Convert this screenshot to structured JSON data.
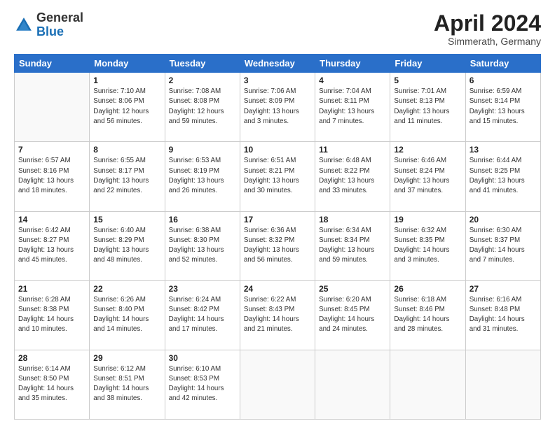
{
  "header": {
    "logo_general": "General",
    "logo_blue": "Blue",
    "month": "April 2024",
    "location": "Simmerath, Germany"
  },
  "weekdays": [
    "Sunday",
    "Monday",
    "Tuesday",
    "Wednesday",
    "Thursday",
    "Friday",
    "Saturday"
  ],
  "weeks": [
    [
      {
        "day": "",
        "info": ""
      },
      {
        "day": "1",
        "info": "Sunrise: 7:10 AM\nSunset: 8:06 PM\nDaylight: 12 hours\nand 56 minutes."
      },
      {
        "day": "2",
        "info": "Sunrise: 7:08 AM\nSunset: 8:08 PM\nDaylight: 12 hours\nand 59 minutes."
      },
      {
        "day": "3",
        "info": "Sunrise: 7:06 AM\nSunset: 8:09 PM\nDaylight: 13 hours\nand 3 minutes."
      },
      {
        "day": "4",
        "info": "Sunrise: 7:04 AM\nSunset: 8:11 PM\nDaylight: 13 hours\nand 7 minutes."
      },
      {
        "day": "5",
        "info": "Sunrise: 7:01 AM\nSunset: 8:13 PM\nDaylight: 13 hours\nand 11 minutes."
      },
      {
        "day": "6",
        "info": "Sunrise: 6:59 AM\nSunset: 8:14 PM\nDaylight: 13 hours\nand 15 minutes."
      }
    ],
    [
      {
        "day": "7",
        "info": "Sunrise: 6:57 AM\nSunset: 8:16 PM\nDaylight: 13 hours\nand 18 minutes."
      },
      {
        "day": "8",
        "info": "Sunrise: 6:55 AM\nSunset: 8:17 PM\nDaylight: 13 hours\nand 22 minutes."
      },
      {
        "day": "9",
        "info": "Sunrise: 6:53 AM\nSunset: 8:19 PM\nDaylight: 13 hours\nand 26 minutes."
      },
      {
        "day": "10",
        "info": "Sunrise: 6:51 AM\nSunset: 8:21 PM\nDaylight: 13 hours\nand 30 minutes."
      },
      {
        "day": "11",
        "info": "Sunrise: 6:48 AM\nSunset: 8:22 PM\nDaylight: 13 hours\nand 33 minutes."
      },
      {
        "day": "12",
        "info": "Sunrise: 6:46 AM\nSunset: 8:24 PM\nDaylight: 13 hours\nand 37 minutes."
      },
      {
        "day": "13",
        "info": "Sunrise: 6:44 AM\nSunset: 8:25 PM\nDaylight: 13 hours\nand 41 minutes."
      }
    ],
    [
      {
        "day": "14",
        "info": "Sunrise: 6:42 AM\nSunset: 8:27 PM\nDaylight: 13 hours\nand 45 minutes."
      },
      {
        "day": "15",
        "info": "Sunrise: 6:40 AM\nSunset: 8:29 PM\nDaylight: 13 hours\nand 48 minutes."
      },
      {
        "day": "16",
        "info": "Sunrise: 6:38 AM\nSunset: 8:30 PM\nDaylight: 13 hours\nand 52 minutes."
      },
      {
        "day": "17",
        "info": "Sunrise: 6:36 AM\nSunset: 8:32 PM\nDaylight: 13 hours\nand 56 minutes."
      },
      {
        "day": "18",
        "info": "Sunrise: 6:34 AM\nSunset: 8:34 PM\nDaylight: 13 hours\nand 59 minutes."
      },
      {
        "day": "19",
        "info": "Sunrise: 6:32 AM\nSunset: 8:35 PM\nDaylight: 14 hours\nand 3 minutes."
      },
      {
        "day": "20",
        "info": "Sunrise: 6:30 AM\nSunset: 8:37 PM\nDaylight: 14 hours\nand 7 minutes."
      }
    ],
    [
      {
        "day": "21",
        "info": "Sunrise: 6:28 AM\nSunset: 8:38 PM\nDaylight: 14 hours\nand 10 minutes."
      },
      {
        "day": "22",
        "info": "Sunrise: 6:26 AM\nSunset: 8:40 PM\nDaylight: 14 hours\nand 14 minutes."
      },
      {
        "day": "23",
        "info": "Sunrise: 6:24 AM\nSunset: 8:42 PM\nDaylight: 14 hours\nand 17 minutes."
      },
      {
        "day": "24",
        "info": "Sunrise: 6:22 AM\nSunset: 8:43 PM\nDaylight: 14 hours\nand 21 minutes."
      },
      {
        "day": "25",
        "info": "Sunrise: 6:20 AM\nSunset: 8:45 PM\nDaylight: 14 hours\nand 24 minutes."
      },
      {
        "day": "26",
        "info": "Sunrise: 6:18 AM\nSunset: 8:46 PM\nDaylight: 14 hours\nand 28 minutes."
      },
      {
        "day": "27",
        "info": "Sunrise: 6:16 AM\nSunset: 8:48 PM\nDaylight: 14 hours\nand 31 minutes."
      }
    ],
    [
      {
        "day": "28",
        "info": "Sunrise: 6:14 AM\nSunset: 8:50 PM\nDaylight: 14 hours\nand 35 minutes."
      },
      {
        "day": "29",
        "info": "Sunrise: 6:12 AM\nSunset: 8:51 PM\nDaylight: 14 hours\nand 38 minutes."
      },
      {
        "day": "30",
        "info": "Sunrise: 6:10 AM\nSunset: 8:53 PM\nDaylight: 14 hours\nand 42 minutes."
      },
      {
        "day": "",
        "info": ""
      },
      {
        "day": "",
        "info": ""
      },
      {
        "day": "",
        "info": ""
      },
      {
        "day": "",
        "info": ""
      }
    ]
  ]
}
